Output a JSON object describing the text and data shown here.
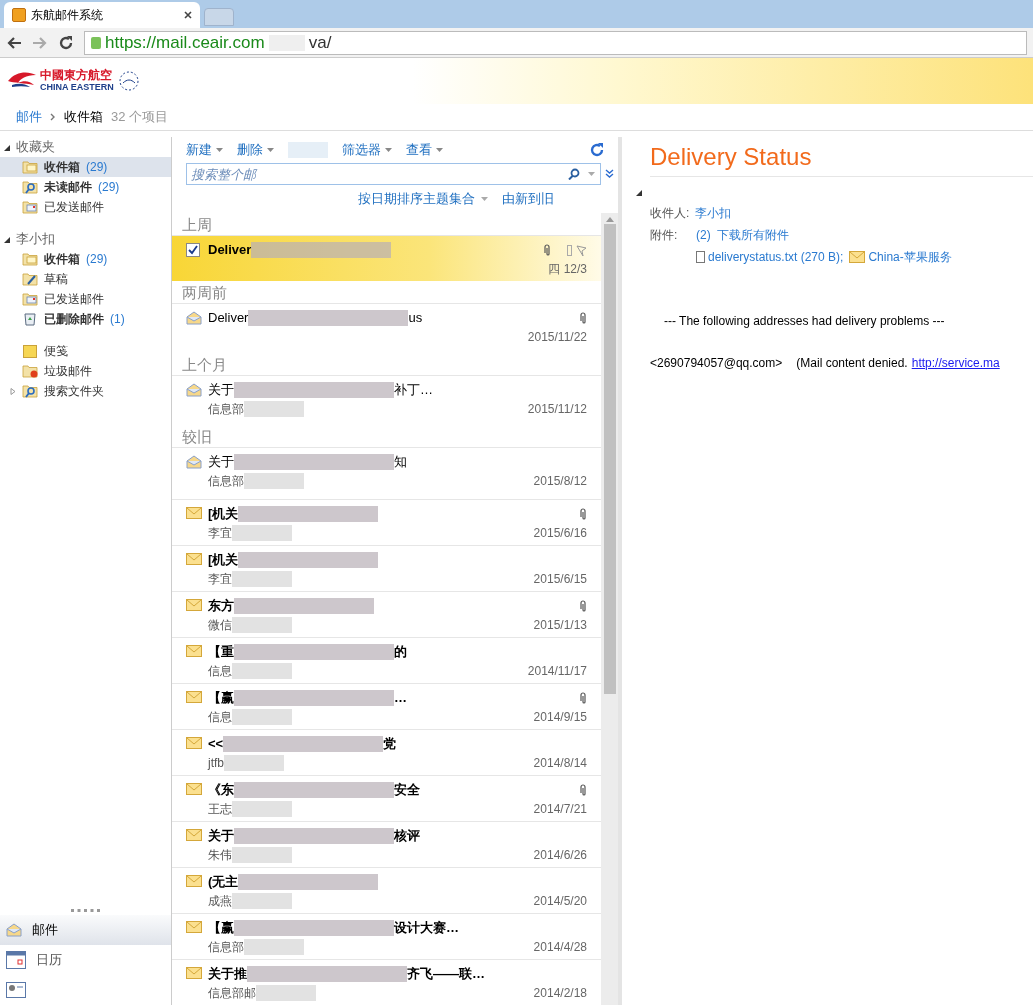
{
  "browser": {
    "tab_title": "东航邮件系统",
    "url_start": "https://mail.ceair.com",
    "url_end": "va/"
  },
  "header": {
    "logo_cn": "中國東方航空",
    "logo_en": "CHINA EASTERN"
  },
  "breadcrumb": {
    "root": "邮件",
    "current": "收件箱",
    "count": "32 个项目"
  },
  "sidebar": {
    "groups": [
      {
        "title": "收藏夹",
        "expanded": true,
        "items": [
          {
            "kind": "inbox",
            "label": "收件箱",
            "count": "(29)",
            "bold": true,
            "selected": true
          },
          {
            "kind": "search",
            "label": "未读邮件",
            "count": "(29)",
            "bold": true,
            "selected": false
          },
          {
            "kind": "sent",
            "label": "已发送邮件",
            "bold": false,
            "selected": false
          }
        ]
      },
      {
        "title": "李小扣",
        "expanded": true,
        "items": [
          {
            "kind": "inbox",
            "label": "收件箱",
            "count": "(29)",
            "bold": true,
            "selected": false
          },
          {
            "kind": "drafts",
            "label": "草稿",
            "bold": false,
            "selected": false
          },
          {
            "kind": "sent",
            "label": "已发送邮件",
            "bold": false,
            "selected": false
          },
          {
            "kind": "deleted",
            "label": "已删除邮件",
            "count": "(1)",
            "bold": true,
            "selected": false
          }
        ]
      },
      {
        "items": [
          {
            "kind": "notes",
            "label": "便笺",
            "bold": false,
            "selected": false
          },
          {
            "kind": "junk",
            "label": "垃圾邮件",
            "bold": false,
            "selected": false
          },
          {
            "kind": "search",
            "label": "搜索文件夹",
            "bold": false,
            "selected": false,
            "expandable": true
          }
        ]
      }
    ],
    "nav": [
      {
        "kind": "mail",
        "label": "邮件",
        "selected": true
      },
      {
        "kind": "calendar",
        "label": "日历",
        "selected": false
      },
      {
        "kind": "contacts",
        "selected": false
      }
    ]
  },
  "toolbar": {
    "items": [
      "新建",
      "删除",
      "筛选器",
      "查看"
    ],
    "search_placeholder": "搜索整个邮",
    "sort": "按日期排序主题集合",
    "order": "由新到旧"
  },
  "message_groups": [
    {
      "title": "上周",
      "messages": [
        {
          "subject": "Deliver",
          "date": "四 12/3",
          "attachment": true,
          "unread": true,
          "selected": true,
          "flag": true
        }
      ]
    },
    {
      "title": "两周前",
      "messages": [
        {
          "subject": "Deliver",
          "subject_end": "us",
          "date": "2015/11/22",
          "attachment": true,
          "unread": false,
          "selected": false
        }
      ]
    },
    {
      "title": "上个月",
      "messages": [
        {
          "subject": "关于",
          "subject_end": "补丁…",
          "sender": "信息部",
          "date": "2015/11/12",
          "attachment": false,
          "unread": false,
          "selected": false
        }
      ]
    },
    {
      "title": "较旧",
      "messages": [
        {
          "subject": "关于",
          "subject_end": "知",
          "sender": "信息部",
          "date": "2015/8/12",
          "attachment": false,
          "unread": false,
          "selected": false
        },
        {
          "subject": "[机关",
          "sender": "李宜",
          "date": "2015/6/16",
          "attachment": true,
          "unread": true,
          "selected": false
        },
        {
          "subject": "[机关",
          "sender": "李宜",
          "date": "2015/6/15",
          "attachment": false,
          "unread": true,
          "selected": false
        },
        {
          "subject": "东方",
          "sender": "微信",
          "date": "2015/1/13",
          "attachment": true,
          "unread": true,
          "selected": false
        },
        {
          "subject": "【重",
          "subject_end": "的",
          "sender": "信息",
          "date": "2014/11/17",
          "attachment": false,
          "unread": true,
          "selected": false
        },
        {
          "subject": "【赢",
          "subject_end": "…",
          "sender": "信息",
          "date": "2014/9/15",
          "attachment": true,
          "unread": true,
          "selected": false
        },
        {
          "subject": "<<",
          "subject_end": "党",
          "sender": "jtfb",
          "date": "2014/8/14",
          "attachment": false,
          "unread": true,
          "selected": false
        },
        {
          "subject": "《东",
          "subject_end": "安全",
          "sender": "王志",
          "date": "2014/7/21",
          "attachment": true,
          "unread": true,
          "selected": false
        },
        {
          "subject": "关于",
          "subject_end": "核评",
          "sender": "朱伟",
          "date": "2014/6/26",
          "attachment": false,
          "unread": true,
          "selected": false
        },
        {
          "subject": "(无主",
          "sender": "成燕",
          "date": "2014/5/20",
          "attachment": false,
          "unread": true,
          "selected": false
        },
        {
          "subject": "【赢",
          "subject_end": "设计大赛…",
          "sender": "信息部",
          "date": "2014/4/28",
          "attachment": false,
          "unread": true,
          "selected": false
        },
        {
          "subject": "关于推",
          "subject_end": "齐飞——联…",
          "sender": "信息部邮",
          "date": "2014/2/18",
          "attachment": false,
          "unread": true,
          "selected": false
        }
      ]
    }
  ],
  "reading_pane": {
    "subject": "Delivery Status",
    "to_label": "收件人:",
    "to": "李小扣",
    "attach_label": "附件:",
    "attach_count": "(2)",
    "download_all": "下载所有附件",
    "attachments": [
      {
        "kind": "file",
        "name": "deliverystatus.txt (270 B);"
      },
      {
        "kind": "mail",
        "name": "China-苹果服务"
      }
    ],
    "body_line": "--- The following addresses had delivery problems ---",
    "address": "<2690794057@qq.com>",
    "reason": "(Mail content denied.",
    "link": "http://service.ma"
  }
}
